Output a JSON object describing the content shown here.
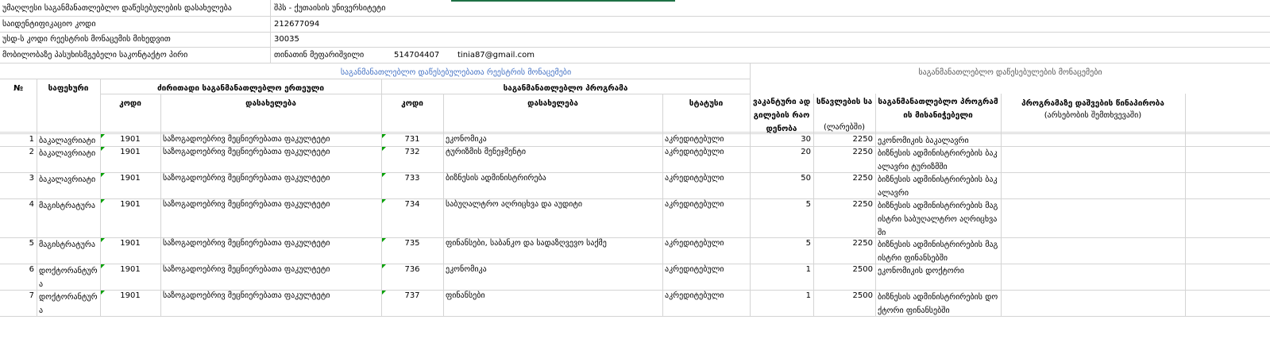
{
  "info": [
    {
      "label": "უმაღლესი საგანმანათლებლო დაწესებულების დასახელება",
      "value": "შპს - ქუთაისის უნივერსიტეტი"
    },
    {
      "label": "საიდენტიფიკაციო კოდი",
      "value": "212677094"
    },
    {
      "label": "უსდ-ს კოდი რეესტრის მონაცემის მიხედვით",
      "value": "30035"
    },
    {
      "label": "მობილობაზე პასუხისმგებელი საკონტაქტო პირი",
      "value": "თინათინ მეფარიშვილი",
      "phone": "514704407",
      "email": "tinia87@gmail.com"
    }
  ],
  "headers": {
    "registry_section": "საგანმანათლებლო დაწესებულებათა რეესტრის მონაცემები",
    "institution_section": "საგანმანათლებლო დაწესებულების მონაცემები",
    "num": "№",
    "level": "საფეხური",
    "main_unit": "ძირითადი საგანმანათლებლო ერთეული",
    "program": "საგანმანათლებლო პროგრამა",
    "code": "კოდი",
    "name": "დასახელება",
    "status": "სტატუსი",
    "vacant": "ვაკანტური ადგილების რაოდენობა",
    "fee": "სწავლების საფასური",
    "fee_unit": "(ლარებში)",
    "qualification": "საგანმანათლებლო პროგრამის მისანიჭებელი",
    "prerequisite": "პროგრამაზე დაშვების წინაპირობა",
    "prerequisite_note": "(არსებობის შემთხვევაში)"
  },
  "rows": [
    {
      "num": "1",
      "level": "ბაკალავრიატი",
      "unit_code": "1901",
      "unit_name": "საზოგადოებრივ მეცნიერებათა ფაკულტეტი",
      "prog_code": "731",
      "prog_name": "ეკონომიკა",
      "status": "აკრედიტებული",
      "vacant": "30",
      "fee": "2250",
      "qualification": "ეკონომიკის ბაკალავრი",
      "prerequisite": ""
    },
    {
      "num": "2",
      "level": "ბაკალავრიატი",
      "unit_code": "1901",
      "unit_name": "საზოგადოებრივ მეცნიერებათა ფაკულტეტი",
      "prog_code": "732",
      "prog_name": "ტურიზმის მენეჯმენტი",
      "status": "აკრედიტებული",
      "vacant": "20",
      "fee": "2250",
      "qualification": "ბიზნესის ადმინისტრირების ბაკალავრი ტურიზმში",
      "prerequisite": ""
    },
    {
      "num": "3",
      "level": "ბაკალავრიატი",
      "unit_code": "1901",
      "unit_name": "საზოგადოებრივ მეცნიერებათა ფაკულტეტი",
      "prog_code": "733",
      "prog_name": "ბიზნესის ადმინისტრირება",
      "status": "აკრედიტებული",
      "vacant": "50",
      "fee": "2250",
      "qualification": "ბიზნესის ადმინისტრირების ბაკალავრი",
      "prerequisite": ""
    },
    {
      "num": "4",
      "level": "მაგისტრატურა",
      "unit_code": "1901",
      "unit_name": "საზოგადოებრივ მეცნიერებათა ფაკულტეტი",
      "prog_code": "734",
      "prog_name": "საბუღალტრო აღრიცხვა და აუდიტი",
      "status": "აკრედიტებული",
      "vacant": "5",
      "fee": "2250",
      "qualification": "ბიზნესის ადმინისტრირების მაგისტრი საბუღალტრო აღრიცხვაში",
      "prerequisite": ""
    },
    {
      "num": "5",
      "level": "მაგისტრატურა",
      "unit_code": "1901",
      "unit_name": "საზოგადოებრივ მეცნიერებათა ფაკულტეტი",
      "prog_code": "735",
      "prog_name": "ფინანსები, საბანკო და სადაზღვევო საქმე",
      "status": "აკრედიტებული",
      "vacant": "5",
      "fee": "2250",
      "qualification": "ბიზნესის ადმინისტრირების მაგისტრი ფინანსებში",
      "prerequisite": ""
    },
    {
      "num": "6",
      "level": "დოქტორანტურა",
      "unit_code": "1901",
      "unit_name": "საზოგადოებრივ მეცნიერებათა ფაკულტეტი",
      "prog_code": "736",
      "prog_name": "ეკონომიკა",
      "status": "აკრედიტებული",
      "vacant": "1",
      "fee": "2500",
      "qualification": "ეკონომიკის დოქტორი",
      "prerequisite": ""
    },
    {
      "num": "7",
      "level": "დოქტორანტურა",
      "unit_code": "1901",
      "unit_name": "საზოგადოებრივ მეცნიერებათა ფაკულტეტი",
      "prog_code": "737",
      "prog_name": "ფინანსები",
      "status": "აკრედიტებული",
      "vacant": "1",
      "fee": "2500",
      "qualification": "ბიზნესის ადმინისტრირების დოქტორი ფინანსებში",
      "prerequisite": ""
    }
  ]
}
